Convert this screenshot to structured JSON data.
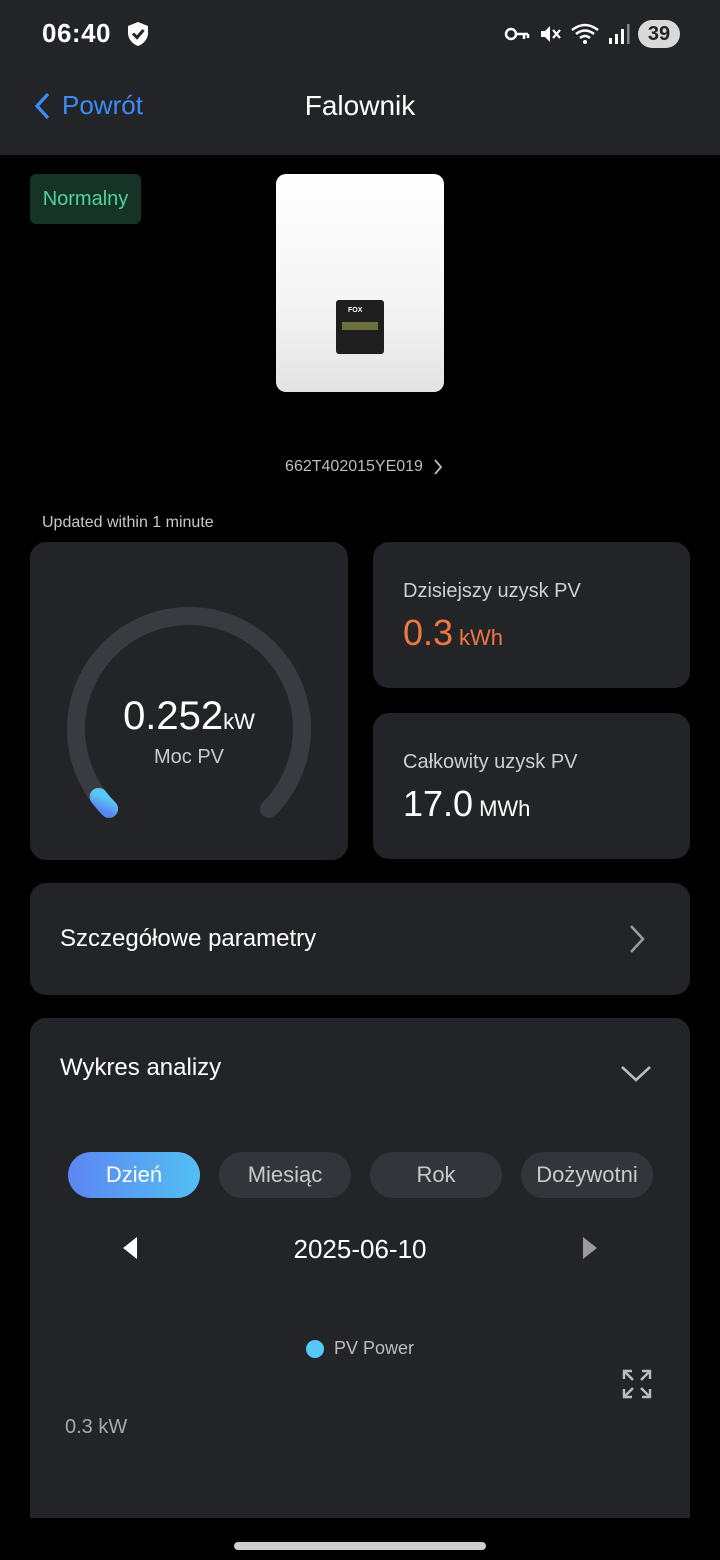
{
  "status_bar": {
    "time": "06:40",
    "battery": "39"
  },
  "header": {
    "back_label": "Powrót",
    "title": "Falownik"
  },
  "device": {
    "status": "Normalny",
    "logo": "FOX",
    "serial": "662T402015YE019"
  },
  "updated_text": "Updated  within 1 minute",
  "pv_power": {
    "value": "0.252",
    "unit": "kW",
    "label": "Moc PV",
    "gauge_fraction": 0.03
  },
  "today_yield": {
    "label": "Dzisiejszy uzysk PV",
    "value": "0.3",
    "unit": "kWh"
  },
  "total_yield": {
    "label": "Całkowity uzysk PV",
    "value": "17.0",
    "unit": "MWh"
  },
  "details": {
    "label": "Szczegółowe parametry"
  },
  "analysis": {
    "title": "Wykres analizy",
    "tabs": [
      {
        "label": "Dzień",
        "active": true
      },
      {
        "label": "Miesiąc",
        "active": false
      },
      {
        "label": "Rok",
        "active": false
      },
      {
        "label": "Dożywotni",
        "active": false
      }
    ],
    "date": "2025-06-10",
    "legend": "PV Power",
    "y_label": "0.3 kW"
  },
  "colors": {
    "accent_blue": "#3d8cf5",
    "orange": "#f2763f",
    "status_green": "#4fd49a",
    "gauge_cyan": "#55c8f5"
  }
}
